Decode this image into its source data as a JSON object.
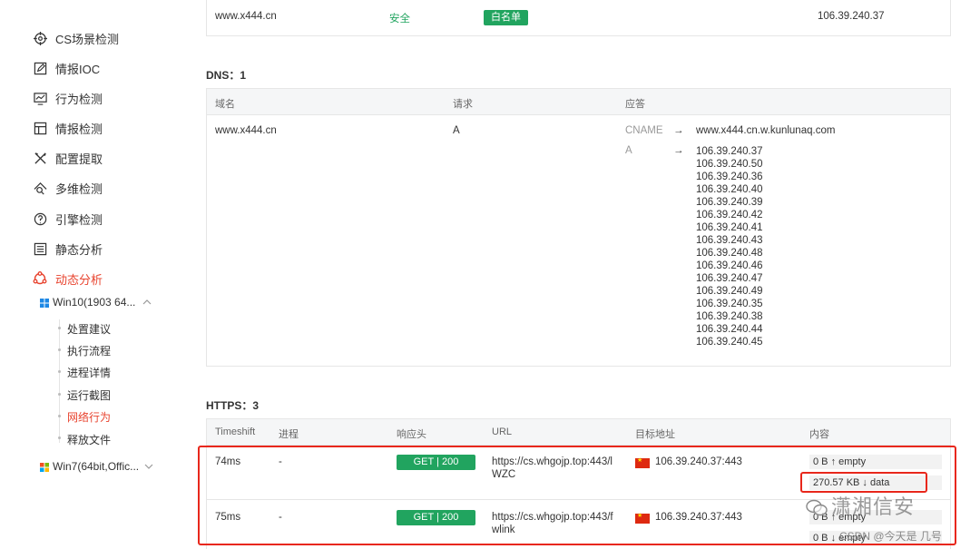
{
  "sidebar": {
    "items": [
      {
        "label": "CS场景检测",
        "icon": "crosshair-icon"
      },
      {
        "label": "情报IOC",
        "icon": "edit-icon"
      },
      {
        "label": "行为检测",
        "icon": "chart-icon"
      },
      {
        "label": "情报检测",
        "icon": "layout-icon"
      },
      {
        "label": "配置提取",
        "icon": "tools-icon"
      },
      {
        "label": "多维检测",
        "icon": "search-icon"
      },
      {
        "label": "引擎检测",
        "icon": "engine-icon"
      },
      {
        "label": "静态分析",
        "icon": "list-icon"
      },
      {
        "label": "动态分析",
        "icon": "dynamic-icon"
      }
    ],
    "env1": "Win10(1903 64...",
    "env1_subitems": [
      "处置建议",
      "执行流程",
      "进程详情",
      "运行截图",
      "网络行为",
      "释放文件"
    ],
    "env2": "Win7(64bit,Offic...",
    "active_color": "#e8432e"
  },
  "top_row": {
    "domain": "www.x444.cn",
    "status": "安全",
    "badge": "白名单",
    "ip": "106.39.240.37"
  },
  "dns": {
    "title": "DNS：1",
    "headers": [
      "域名",
      "请求",
      "应答"
    ],
    "domain": "www.x444.cn",
    "request": "A",
    "cname_label": "CNAME",
    "cname_value": "www.x444.cn.w.kunlunaq.com",
    "a_label": "A",
    "arrow": "→",
    "ips": [
      "106.39.240.37",
      "106.39.240.50",
      "106.39.240.36",
      "106.39.240.40",
      "106.39.240.39",
      "106.39.240.42",
      "106.39.240.41",
      "106.39.240.43",
      "106.39.240.48",
      "106.39.240.46",
      "106.39.240.47",
      "106.39.240.49",
      "106.39.240.35",
      "106.39.240.38",
      "106.39.240.44",
      "106.39.240.45"
    ]
  },
  "https": {
    "title": "HTTPS：3",
    "headers": [
      "Timeshift",
      "进程",
      "响应头",
      "URL",
      "目标地址",
      "内容"
    ],
    "rows": [
      {
        "time": "74ms",
        "process": "-",
        "method": "GET | 200",
        "url_line1": "https://cs.whgojp.top:443/l",
        "url_line2": "WZC",
        "target": "106.39.240.37:443",
        "content1": "0 B ↑ empty",
        "content2": "270.57 KB ↓ data"
      },
      {
        "time": "75ms",
        "process": "-",
        "method": "GET | 200",
        "url_line1": "https://cs.whgojp.top:443/f",
        "url_line2": "wlink",
        "target": "106.39.240.37:443",
        "content1": "0 B ↑ empty",
        "content2": "0 B ↓ empty"
      }
    ]
  },
  "watermark": {
    "main": "潇湘信安",
    "sub": "CSDN @今天是 几号"
  }
}
